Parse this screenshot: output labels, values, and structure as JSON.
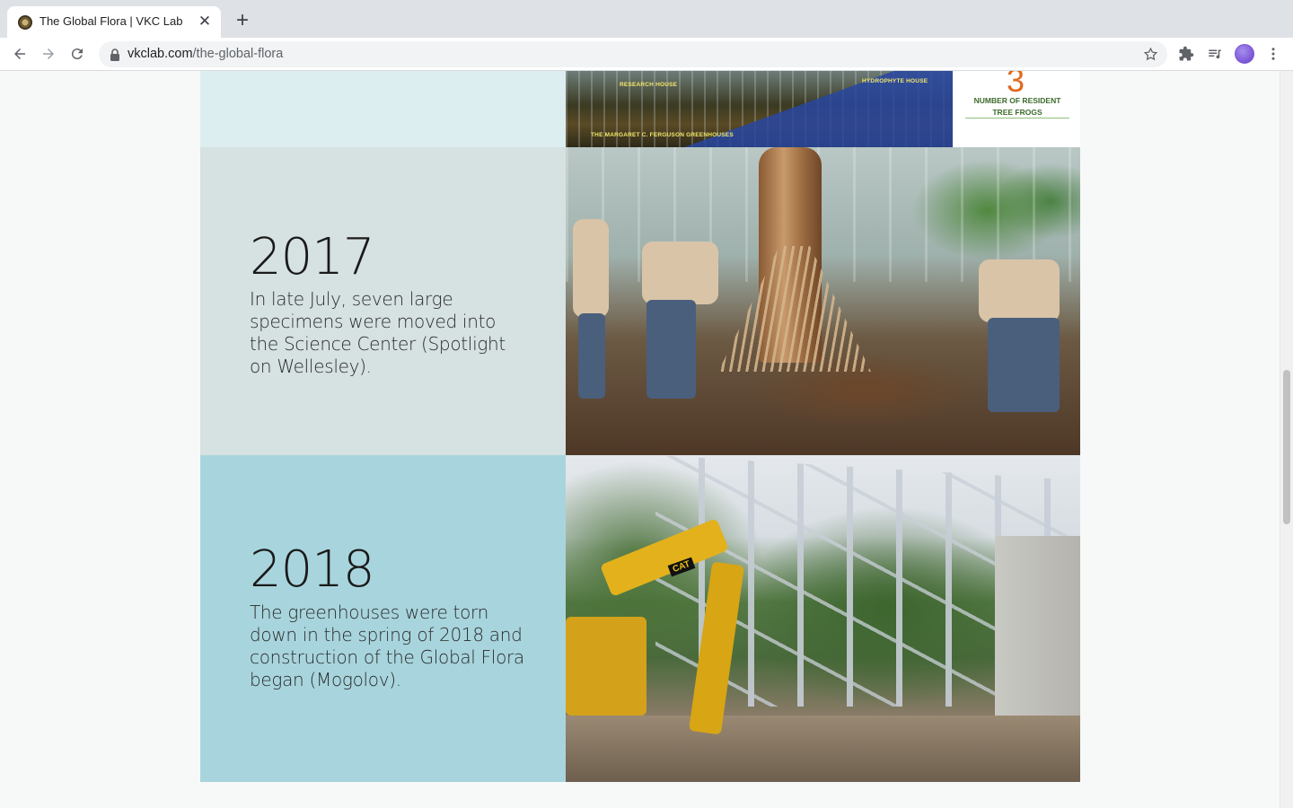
{
  "browser": {
    "tab": {
      "title": "The Global Flora | VKC Lab"
    },
    "address": {
      "host": "vkclab.com",
      "path": "/the-global-flora"
    }
  },
  "page": {
    "top_image": {
      "labels": {
        "research_house": "RESEARCH HOUSE",
        "hydrophyte_house": "HYDROPHYTE HOUSE",
        "greenhouses": "THE MARGARET C. FERGUSON GREENHOUSES"
      },
      "infographic": {
        "number": "3",
        "caption": "NUMBER OF RESIDENT TREE FROGS"
      }
    },
    "timeline": [
      {
        "year": "2017",
        "text": "In late July, seven large specimens were moved into the Science Center (Spotlight on Wellesley)."
      },
      {
        "year": "2018",
        "text": "The greenhouses were torn down in the spring of 2018 and construction of the Global Flora began (Mogolov)."
      }
    ],
    "photo_2018": {
      "brand_mark": "CAT"
    }
  },
  "colors": {
    "row_top_bg": "#ddeef1",
    "row_2017_bg": "#d6e1e1",
    "row_2018_bg": "#a8d5dd",
    "infographic_number": "#e06a1e"
  }
}
